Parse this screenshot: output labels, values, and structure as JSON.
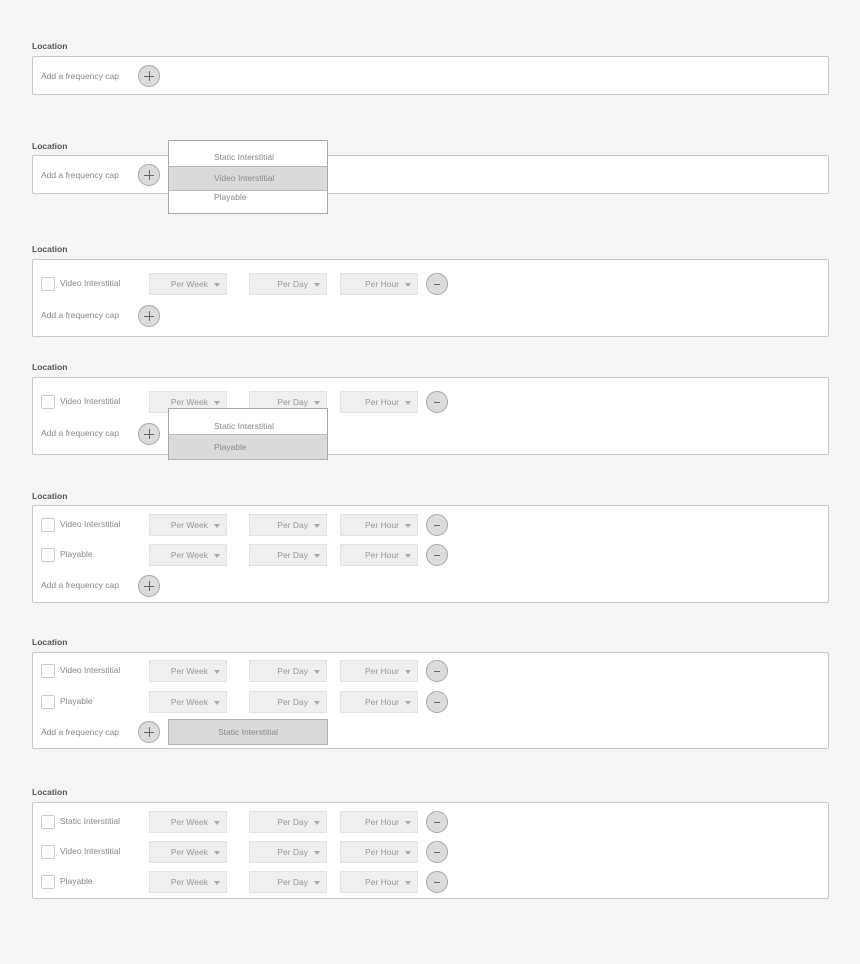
{
  "location_label": "Location",
  "add_cap_label": "Add a frequency cap",
  "period_options": {
    "week": "Per Week",
    "day": "Per Day",
    "hour": "Per Hour"
  },
  "ad_types": [
    "Static Interstitial",
    "Video Interstitial",
    "Playable"
  ],
  "colors": {
    "background": "#f5f5f5",
    "box_border": "#c8c8c8",
    "select_bg": "#efefef",
    "highlight": "#dadada"
  },
  "sections": [
    {
      "state": "empty",
      "rows": []
    },
    {
      "state": "dropdown-open",
      "rows": [],
      "dropdown": {
        "items": [
          "Static Interstitial",
          "Video Interstitial",
          "Playable"
        ],
        "highlighted": "Video Interstitial"
      }
    },
    {
      "state": "one-row",
      "rows": [
        {
          "type": "Video Interstitial",
          "week": "Per Week",
          "day": "Per Day",
          "hour": "Per Hour"
        }
      ]
    },
    {
      "state": "one-row-dropdown-open",
      "rows": [
        {
          "type": "Video Interstitial",
          "week": "Per Week",
          "day": "Per Day",
          "hour": "Per Hour"
        }
      ],
      "dropdown": {
        "items": [
          "Static Interstitial",
          "Playable"
        ],
        "highlighted": "Playable"
      }
    },
    {
      "state": "two-rows",
      "rows": [
        {
          "type": "Video Interstitial",
          "week": "Per Week",
          "day": "Per Day",
          "hour": "Per Hour"
        },
        {
          "type": "Playable",
          "week": "Per Week",
          "day": "Per Day",
          "hour": "Per Hour"
        }
      ]
    },
    {
      "state": "two-rows-last-option",
      "rows": [
        {
          "type": "Video Interstitial",
          "week": "Per Week",
          "day": "Per Day",
          "hour": "Per Hour"
        },
        {
          "type": "Playable",
          "week": "Per Week",
          "day": "Per Day",
          "hour": "Per Hour"
        }
      ],
      "remaining_option": "Static Interstitial"
    },
    {
      "state": "three-rows",
      "rows": [
        {
          "type": "Static Interstitial",
          "week": "Per Week",
          "day": "Per Day",
          "hour": "Per Hour"
        },
        {
          "type": "Video Interstitial",
          "week": "Per Week",
          "day": "Per Day",
          "hour": "Per Hour"
        },
        {
          "type": "Playable",
          "week": "Per Week",
          "day": "Per Day",
          "hour": "Per Hour"
        }
      ]
    }
  ]
}
